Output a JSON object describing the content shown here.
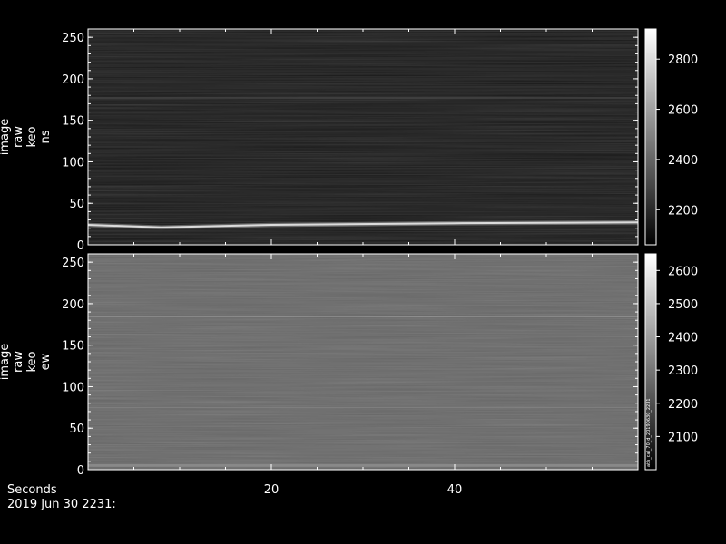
{
  "chart_data": [
    {
      "type": "heatmap",
      "ylabel_lines": [
        "image",
        "raw",
        "keo",
        "ns"
      ],
      "ylim": [
        0,
        260
      ],
      "yticks": [
        0,
        50,
        100,
        150,
        200,
        250
      ],
      "colorbar": {
        "range": [
          2060,
          2920
        ],
        "ticks": [
          2200,
          2400,
          2600,
          2800
        ]
      },
      "background_level": 2140,
      "bands": [
        {
          "y_center": 25,
          "width": 5,
          "peak": 2800,
          "description": "bright band, slightly higher at left"
        },
        {
          "y_center": 177,
          "width": 1.5,
          "peak": 2300
        },
        {
          "y_center": 190,
          "width": 1.2,
          "peak": 2230
        },
        {
          "y_center": 200,
          "width": 1.0,
          "peak": 2210
        },
        {
          "y_center": 212,
          "width": 1.0,
          "peak": 2200
        }
      ],
      "bright_band_center_by_time": [
        [
          0,
          24
        ],
        [
          8,
          21
        ],
        [
          20,
          24
        ],
        [
          40,
          26
        ],
        [
          60,
          27
        ]
      ]
    },
    {
      "type": "heatmap",
      "ylabel_lines": [
        "image",
        "raw",
        "keo",
        "ew"
      ],
      "ylim": [
        0,
        260
      ],
      "yticks": [
        0,
        50,
        100,
        150,
        200,
        250
      ],
      "colorbar": {
        "range": [
          2000,
          2650
        ],
        "ticks": [
          2100,
          2200,
          2300,
          2400,
          2500,
          2600
        ],
        "side_text": "ath_cal_70_d_20190630_2231"
      },
      "background_level": 2260,
      "bands": [
        {
          "y_center": 185,
          "width": 1.2,
          "peak": 2600
        },
        {
          "y_center": 75,
          "width": 1.0,
          "peak": 2330
        },
        {
          "y_center": 5,
          "width": 3,
          "peak": 2350
        }
      ]
    }
  ],
  "xaxis": {
    "label": "Seconds",
    "date_label": "2019 Jun 30 2231:",
    "xlim": [
      0,
      60
    ],
    "xticks": [
      20,
      40
    ]
  }
}
